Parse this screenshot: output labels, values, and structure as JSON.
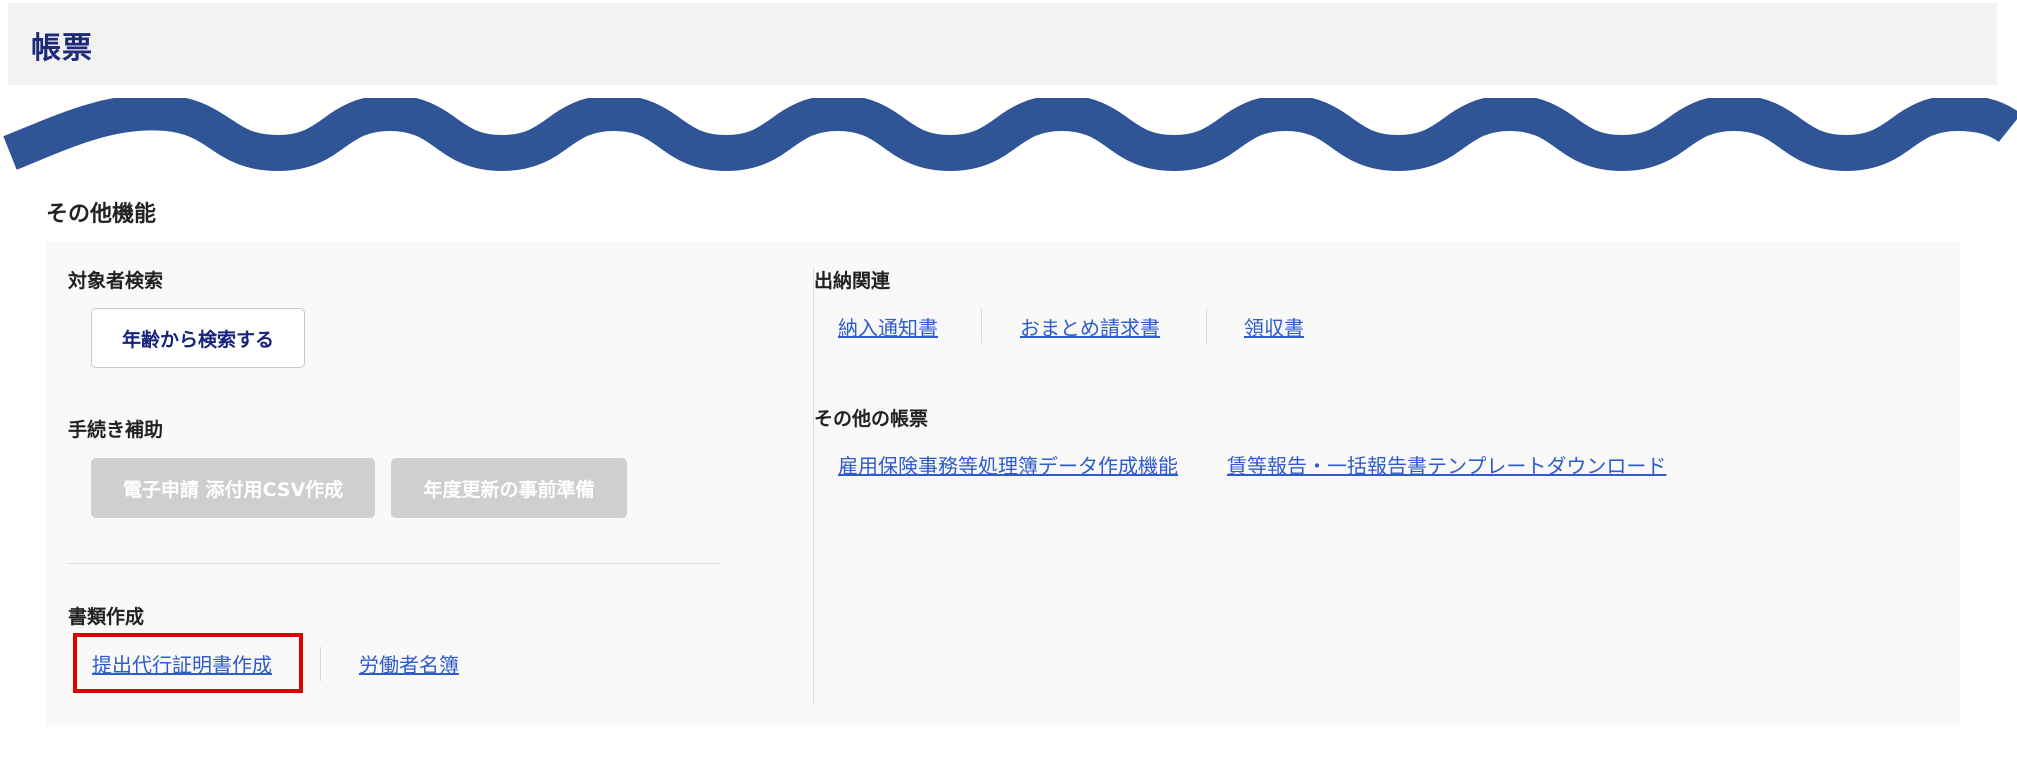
{
  "header": {
    "title": "帳票"
  },
  "section": {
    "title": "その他機能"
  },
  "left": {
    "search": {
      "label": "対象者検索",
      "button": "年齢から検索する"
    },
    "procedures": {
      "label": "手続き補助",
      "buttons": [
        "電子申請 添付用CSV作成",
        "年度更新の事前準備"
      ]
    },
    "documents": {
      "label": "書類作成",
      "links": [
        "提出代行証明書作成",
        "労働者名簿"
      ]
    }
  },
  "right": {
    "payments": {
      "label": "出納関連",
      "links": [
        "納入通知書",
        "おまとめ請求書",
        "領収書"
      ]
    },
    "other_reports": {
      "label": "その他の帳票",
      "links": [
        "雇用保険事務等処理簿データ作成機能",
        "賃等報告・一括報告書テンプレートダウンロード"
      ]
    }
  },
  "colors": {
    "accent": "#2f5597",
    "highlight": "#e00000",
    "link": "#2e5ccc",
    "title": "#1c2a7a"
  }
}
